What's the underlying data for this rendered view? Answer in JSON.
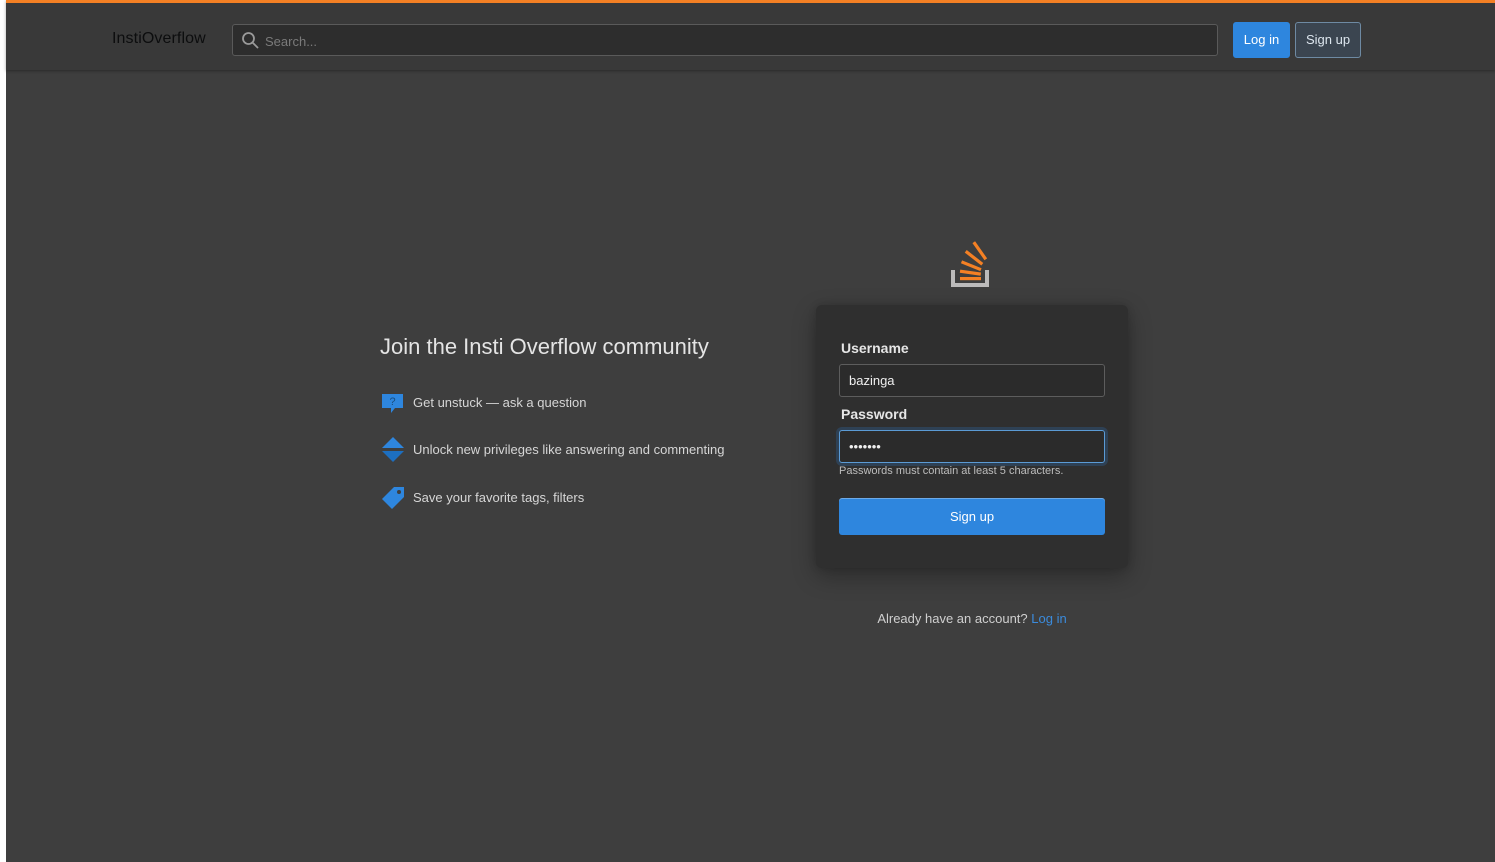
{
  "header": {
    "brand": "InstiOverflow",
    "search_placeholder": "Search...",
    "login_label": "Log in",
    "signup_label": "Sign up"
  },
  "intro": {
    "title": "Join the Insti Overflow community",
    "features": [
      {
        "icon": "question-bubble-icon",
        "text": "Get unstuck — ask a question"
      },
      {
        "icon": "vote-arrows-icon",
        "text": "Unlock new privileges like answering and commenting"
      },
      {
        "icon": "tag-icon",
        "text": "Save your favorite tags, filters"
      }
    ]
  },
  "form": {
    "username_label": "Username",
    "username_value": "bazinga",
    "password_label": "Password",
    "password_value": "•••••••",
    "password_hint": "Passwords must contain at least 5 characters.",
    "submit_label": "Sign up"
  },
  "footer": {
    "already_text": "Already have an account?",
    "login_link": "Log in"
  },
  "colors": {
    "accent": "#f48024",
    "primary_blue": "#2e86de",
    "background": "#3e3e3e",
    "card": "#2f2f2f"
  }
}
